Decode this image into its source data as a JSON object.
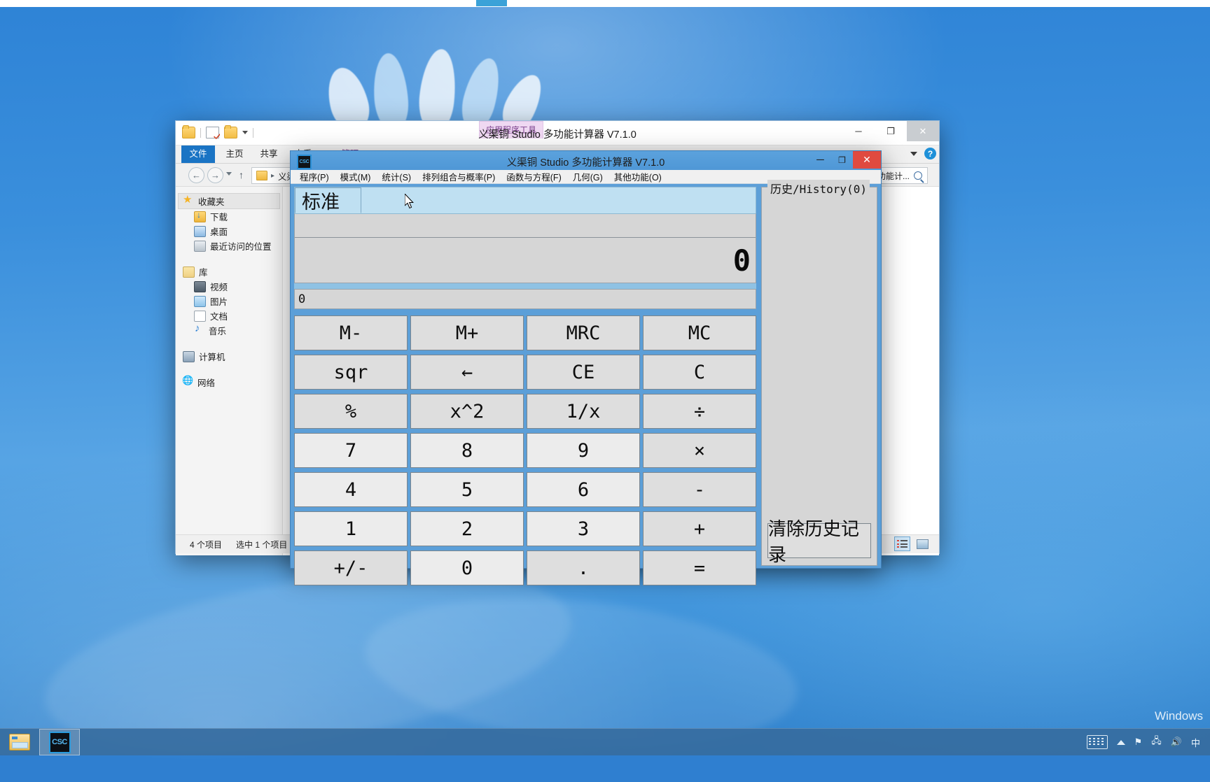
{
  "desktop": {
    "watermark": "Windows"
  },
  "explorer": {
    "title": "义渠铜 Studio 多功能计算器 V7.1.0",
    "contextual_tab": "应用程序工具",
    "quick_access": [
      "folder-icon",
      "properties-icon",
      "new-folder-icon",
      "customize-caret-icon"
    ],
    "ribbon_tabs": [
      {
        "label": "文件",
        "selected": true
      },
      {
        "label": "主页",
        "selected": false
      },
      {
        "label": "共享",
        "selected": false
      },
      {
        "label": "查看",
        "selected": false
      },
      {
        "label": "管理",
        "selected": false,
        "contextual": true
      }
    ],
    "address": "义渠",
    "search_value": "功能计...",
    "window_controls": {
      "minimize": "─",
      "maximize": "❐",
      "close": "✕"
    },
    "nav": {
      "favorites": "收藏夹",
      "items_fav": [
        "下载",
        "桌面",
        "最近访问的位置"
      ],
      "library": "库",
      "items_lib": [
        "视频",
        "图片",
        "文档",
        "音乐"
      ],
      "computer": "计算机",
      "network": "网络"
    },
    "status": {
      "count": "4 个项目",
      "selected": "选中 1 个项目"
    }
  },
  "calculator": {
    "title": "义渠铜 Studio 多功能计算器 V7.1.0",
    "icon_label": "CSC",
    "window_controls": {
      "minimize": "─",
      "maximize": "❐",
      "close": "✕"
    },
    "menu": [
      "程序(P)",
      "模式(M)",
      "统计(S)",
      "排列组合与概率(P)",
      "函数与方程(F)",
      "几何(G)",
      "其他功能(O)"
    ],
    "mode_tab": "标准",
    "display": {
      "expression": "",
      "main": "0",
      "sub": "0"
    },
    "keys": [
      {
        "label": "M-",
        "type": "mem"
      },
      {
        "label": "M+",
        "type": "mem"
      },
      {
        "label": "MRC",
        "type": "mem"
      },
      {
        "label": "MC",
        "type": "mem"
      },
      {
        "label": "sqr",
        "type": "func"
      },
      {
        "label": "←",
        "type": "func"
      },
      {
        "label": "CE",
        "type": "func"
      },
      {
        "label": "C",
        "type": "func"
      },
      {
        "label": "%",
        "type": "func"
      },
      {
        "label": "x^2",
        "type": "func"
      },
      {
        "label": "1/x",
        "type": "func"
      },
      {
        "label": "÷",
        "type": "op"
      },
      {
        "label": "7",
        "type": "num"
      },
      {
        "label": "8",
        "type": "num"
      },
      {
        "label": "9",
        "type": "num"
      },
      {
        "label": "×",
        "type": "op"
      },
      {
        "label": "4",
        "type": "num"
      },
      {
        "label": "5",
        "type": "num"
      },
      {
        "label": "6",
        "type": "num"
      },
      {
        "label": "-",
        "type": "op"
      },
      {
        "label": "1",
        "type": "num"
      },
      {
        "label": "2",
        "type": "num"
      },
      {
        "label": "3",
        "type": "num"
      },
      {
        "label": "+",
        "type": "op"
      },
      {
        "label": "+/-",
        "type": "op"
      },
      {
        "label": "0",
        "type": "num"
      },
      {
        "label": ".",
        "type": "op"
      },
      {
        "label": "=",
        "type": "op"
      }
    ],
    "history": {
      "legend": "历史/History(0)",
      "entries": [],
      "clear_button": "清除历史记录"
    }
  },
  "taskbar": {
    "items": [
      {
        "name": "file-explorer",
        "label": "",
        "active": false
      },
      {
        "name": "calculator",
        "label": "CSC",
        "active": true
      }
    ],
    "tray": [
      "keyboard-icon",
      "show-hidden-icon",
      "flag-icon",
      "network-icon",
      "volume-icon",
      "ime-icon"
    ],
    "ime": "中"
  },
  "colors": {
    "accent_blue": "#2f7fd0",
    "calc_frame": "#5c9fd8",
    "calc_tab_bg": "#bfe0f2",
    "display_bg": "#d6d6d6",
    "key_bg": "#dedede",
    "key_num_bg": "#ececec",
    "close_red": "#e04a3f",
    "ribbon_file_blue": "#1a74c4",
    "contextual_purple": "#efd8f2"
  }
}
